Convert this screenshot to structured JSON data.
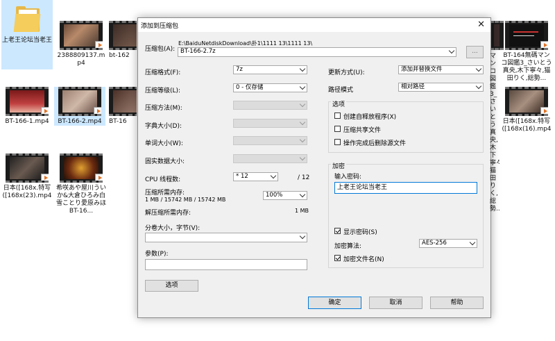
{
  "explorer": {
    "files": [
      {
        "label": "上老王论坛当老王"
      },
      {
        "label": "2388809137.mp4"
      },
      {
        "label": "bt-162"
      },
      {
        "label": "マンコ図鑑3_さいとう真央,木下寧々,猫田りく,総勢..."
      },
      {
        "label": "BT-164無碼マンコ図鑑3_さいとう真央,木下寧々,猫田りく,総勢..."
      },
      {
        "label": "BT-166-1.mp4"
      },
      {
        "label": "BT-166-2.mp4"
      },
      {
        "label": "BT-16"
      },
      {
        "label": "日本([168x.特写([168x(16).mp4"
      },
      {
        "label": "日本([168x.特写([168x(23).mp4"
      },
      {
        "label": "希咲あや屋川うい か&大倉ひろみ白雪ことり愛原みほBT-16..."
      }
    ]
  },
  "dialog": {
    "title": "添加到压缩包",
    "close_glyph": "✕",
    "archive_label": "压缩包(A):",
    "archive_path": "E:\\BaiduNetdiskDownload\\扑1\\1111 13\\1111 13\\",
    "archive_name": "BT-166-2.7z",
    "browse_label": "...",
    "format_label": "压缩格式(F):",
    "format_value": "7z",
    "level_label": "压缩等级(L):",
    "level_value": "0 - 仅存储",
    "method_label": "压缩方法(M):",
    "dict_label": "字典大小(D):",
    "word_label": "单词大小(W):",
    "solid_label": "固实数据大小:",
    "cpu_label": "CPU 线程数:",
    "cpu_value": "* 12",
    "cpu_total": "/ 12",
    "mem_label": "压缩所需内存:",
    "mem_value": "1 MB / 15742 MB / 15742 MB",
    "mem_percent": "100%",
    "decomp_label": "解压缩所需内存:",
    "decomp_value": "1 MB",
    "split_label": "分卷大小，字节(V):",
    "split_value": "",
    "params_label": "参数(P):",
    "params_value": "",
    "options_button": "选项",
    "update_label": "更新方式(U):",
    "update_value": "添加并替换文件",
    "path_label": "路径模式",
    "path_value": "相对路径",
    "options_group": "选项",
    "opt_sfx": "创建自释放程序(X)",
    "opt_shared": "压缩共享文件",
    "opt_delete": "操作完成后删除源文件",
    "encrypt_group": "加密",
    "password_label": "输入密码:",
    "password_value": "上老王论坛当老王",
    "show_password": "显示密码(S)",
    "enc_method_label": "加密算法:",
    "enc_method_value": "AES-256",
    "enc_names": "加密文件名(N)",
    "ok_button": "确定",
    "cancel_button": "取消",
    "help_button": "帮助"
  }
}
